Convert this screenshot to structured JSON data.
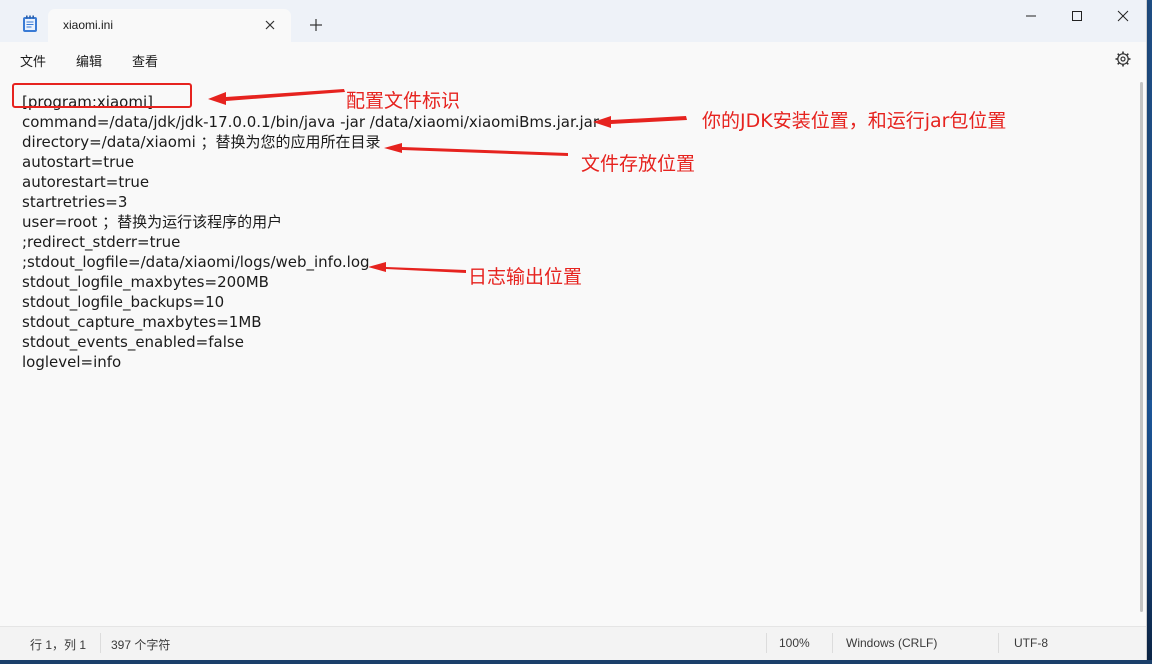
{
  "window": {
    "tab_title": "xiaomi.ini"
  },
  "menu": {
    "file": "文件",
    "edit": "编辑",
    "view": "查看"
  },
  "editor": {
    "lines": [
      "[program:xiaomi]",
      "command=/data/jdk/jdk-17.0.0.1/bin/java -jar /data/xiaomi/xiaomiBms.jar.jar",
      "directory=/data/xiaomi ；替换为您的应用所在目录",
      "autostart=true",
      "autorestart=true",
      "startretries=3",
      "user=root ；替换为运行该程序的用户",
      ";redirect_stderr=true",
      ";stdout_logfile=/data/xiaomi/logs/web_info.log",
      "stdout_logfile_maxbytes=200MB",
      "stdout_logfile_backups=10",
      "stdout_capture_maxbytes=1MB",
      "stdout_events_enabled=false",
      "loglevel=info"
    ]
  },
  "annotations": {
    "config_id": "配置文件标识",
    "jdk_path": "你的JDK安装位置，和运行jar包位置",
    "file_location": "文件存放位置",
    "log_output": "日志输出位置",
    "color": "#e6231f"
  },
  "status": {
    "position": "行 1，列 1",
    "char_count": "397 个字符",
    "zoom": "100%",
    "line_ending": "Windows (CRLF)",
    "encoding": "UTF-8"
  }
}
